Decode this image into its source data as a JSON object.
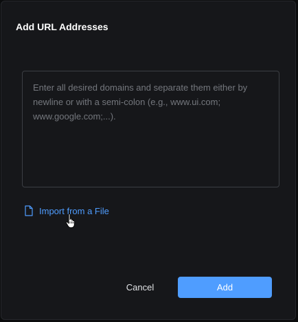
{
  "dialog": {
    "title": "Add URL Addresses",
    "textarea": {
      "value": "",
      "placeholder": "Enter all desired domains and separate them either by newline or with a semi-colon (e.g., www.ui.com; www.google.com;...)."
    },
    "import_link": {
      "label": "Import from a File",
      "icon": "file-icon"
    },
    "cursor_icon": "hand-pointer-icon",
    "actions": {
      "cancel_label": "Cancel",
      "add_label": "Add"
    }
  },
  "colors": {
    "background": "#16171a",
    "accent": "#4f9dff",
    "text_primary": "#ffffff",
    "placeholder": "#74777d",
    "border": "#3c3f44"
  }
}
